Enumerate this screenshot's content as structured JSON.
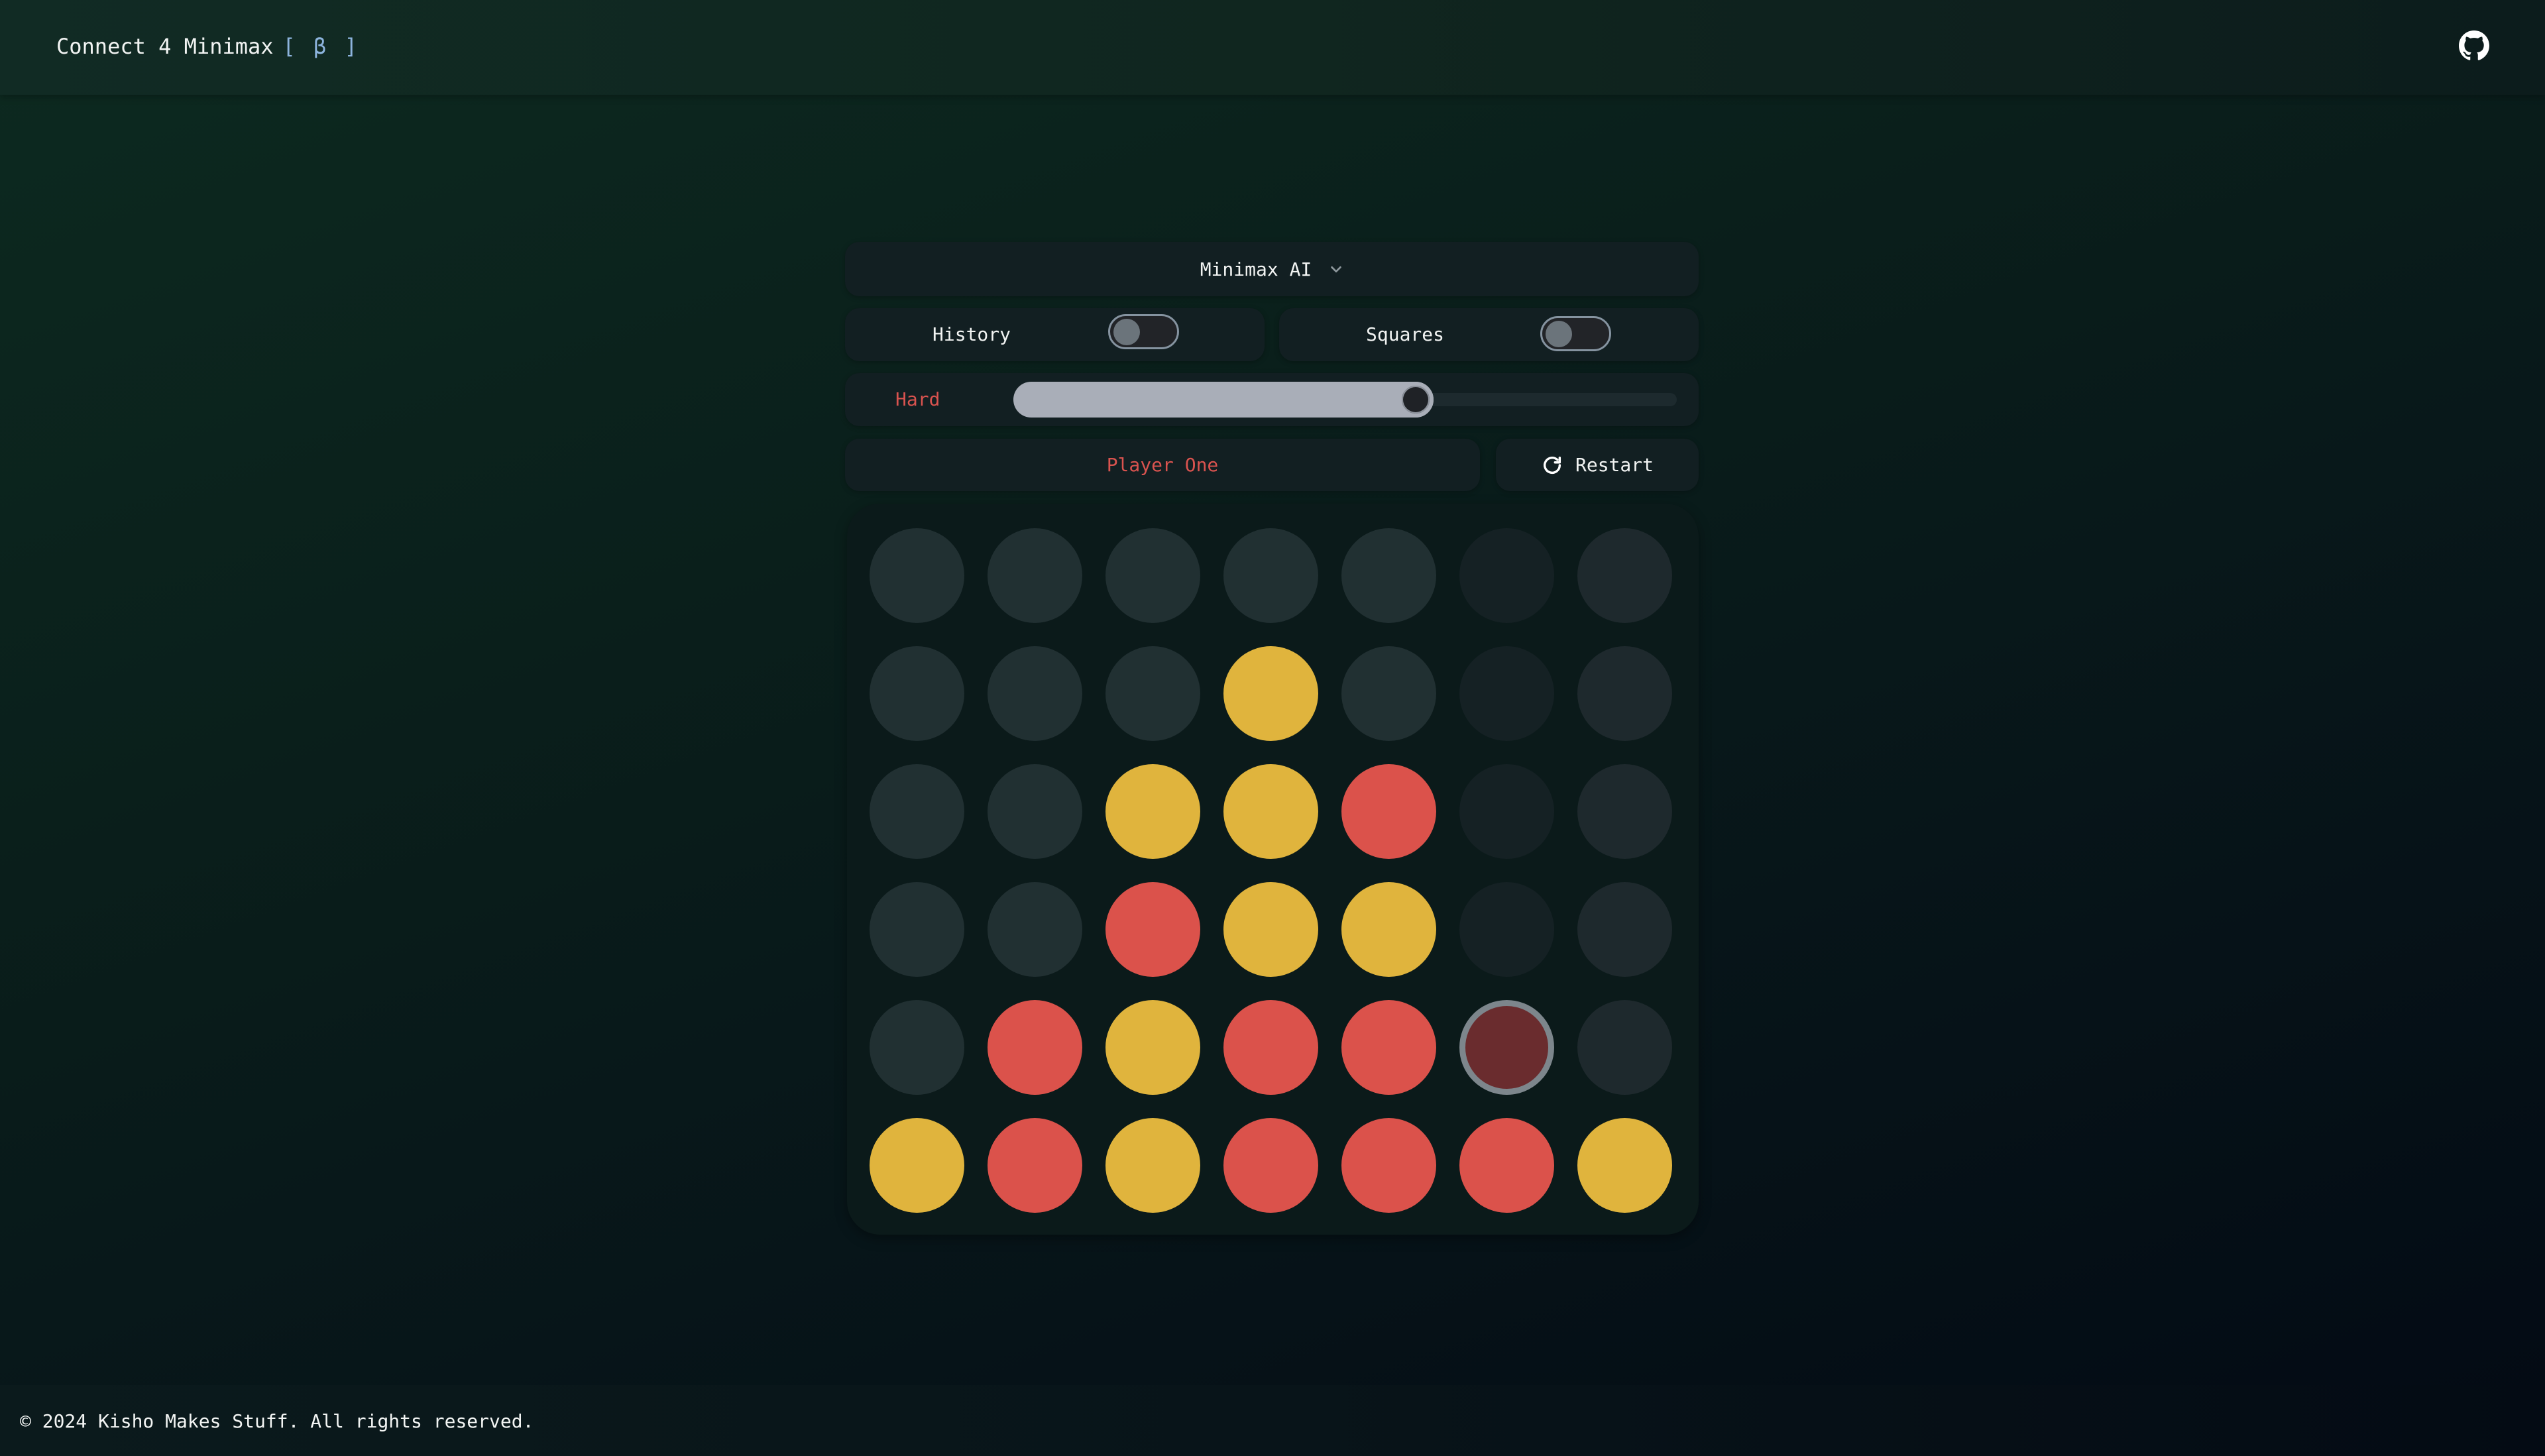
{
  "header": {
    "title": "Connect 4 Minimax",
    "beta_badge": "[ β ]",
    "github_icon": "github-icon"
  },
  "controls": {
    "mode_dropdown": {
      "selected": "Minimax AI",
      "icon": "chevron-down-icon"
    },
    "history_toggle": {
      "label": "History",
      "on": false
    },
    "squares_toggle": {
      "label": "Squares",
      "on": false
    },
    "difficulty": {
      "label": "Hard",
      "value_fraction": 0.6
    },
    "turn_indicator": "Player One",
    "restart_button": {
      "label": "Restart",
      "icon": "refresh-icon"
    }
  },
  "board": {
    "rows": 6,
    "cols": 7,
    "cells": [
      [
        "empty",
        "empty",
        "empty",
        "empty",
        "empty",
        "empty",
        "empty"
      ],
      [
        "empty",
        "empty",
        "empty",
        "yellow",
        "empty",
        "empty",
        "empty"
      ],
      [
        "empty",
        "empty",
        "yellow",
        "yellow",
        "red",
        "empty",
        "empty"
      ],
      [
        "empty",
        "empty",
        "red",
        "yellow",
        "yellow",
        "empty",
        "empty"
      ],
      [
        "empty",
        "red",
        "yellow",
        "red",
        "red",
        "preview",
        "empty"
      ],
      [
        "yellow",
        "red",
        "yellow",
        "red",
        "red",
        "red",
        "yellow"
      ]
    ]
  },
  "colors": {
    "red": "#db524b",
    "yellow": "#e0b43d",
    "empty": "#213032",
    "preview_fill": "#6a2c2e",
    "preview_ring": "#7d868c",
    "accent_red": "#d9534f",
    "beta_blue": "#8db4dd"
  },
  "footer": {
    "copyright": "© 2024 Kisho Makes Stuff. All rights reserved."
  }
}
